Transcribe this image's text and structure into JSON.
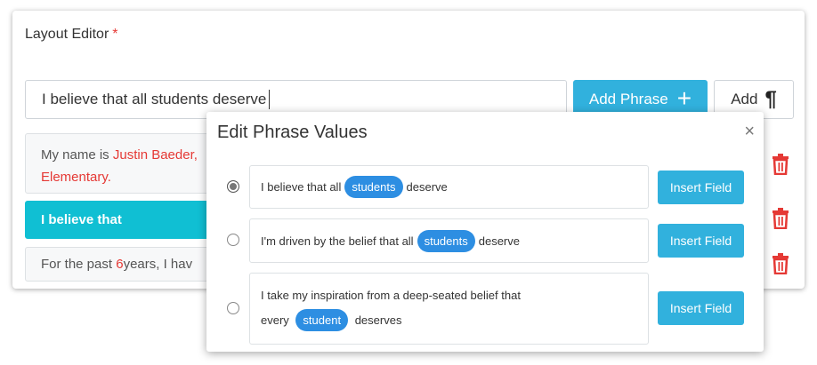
{
  "editor": {
    "title": "Layout Editor",
    "required_mark": "*",
    "input_value": "I believe that all students deserve",
    "add_phrase_label": "Add Phrase",
    "add_phrase_icon": "plus-icon",
    "add_paragraph_label": "Add",
    "add_paragraph_icon": "pilcrow-icon"
  },
  "paragraphs": [
    {
      "prefix": "My name is ",
      "field1": "Justin Baeder,",
      "field2": "Elementary.",
      "suffix": ""
    },
    {
      "text": "I believe that"
    },
    {
      "prefix": "For the past ",
      "field": "6",
      "suffix": " years, I hav"
    }
  ],
  "modal": {
    "title": "Edit Phrase Values",
    "close_icon": "×",
    "options": [
      {
        "selected": true,
        "before": "I believe that all",
        "field": "students",
        "after": "deserve",
        "button": "Insert Field"
      },
      {
        "selected": false,
        "before": "I'm driven by the belief that all",
        "field": "students",
        "after": "deserve",
        "button": "Insert Field"
      },
      {
        "selected": false,
        "line1": "I take my inspiration from a deep-seated belief that",
        "before": "every",
        "field": "student",
        "after": "deserves",
        "button": "Insert Field"
      }
    ]
  },
  "colors": {
    "accent": "#31b1dd",
    "active_paragraph": "#10bfd3",
    "field_pill": "#2d8ee2",
    "danger": "#e53935"
  }
}
